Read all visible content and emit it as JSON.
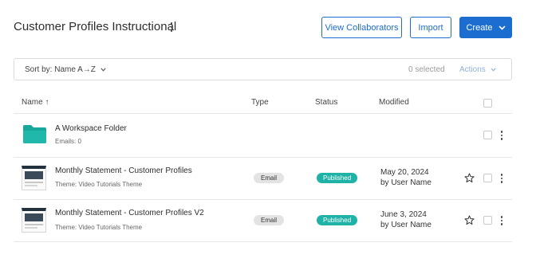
{
  "header": {
    "title": "Customer Profiles Instructional",
    "collaborators_label": "View Collaborators",
    "import_label": "Import",
    "create_label": "Create"
  },
  "toolbar": {
    "sort_label": "Sort by: Name A→Z",
    "selected_text": "0 selected",
    "actions_label": "Actions"
  },
  "table": {
    "columns": {
      "name": "Name ↑",
      "type": "Type",
      "status": "Status",
      "modified": "Modified"
    },
    "rows": [
      {
        "kind": "folder",
        "icon": "folder-icon",
        "title": "A Workspace Folder",
        "subtitle": "Emails: 0"
      },
      {
        "kind": "email",
        "icon": "email-thumbnail",
        "title": "Monthly Statement - Customer Profiles",
        "subtitle": "Theme: Video Tutorials Theme",
        "type": "Email",
        "status": "Published",
        "modified_date": "May 20, 2024",
        "modified_by": "by User Name"
      },
      {
        "kind": "email",
        "icon": "email-thumbnail",
        "title": "Monthly Statement - Customer Profiles V2",
        "subtitle": "Theme: Video Tutorials Theme",
        "type": "Email",
        "status": "Published",
        "modified_date": "June 3, 2024",
        "modified_by": "by User Name"
      }
    ]
  },
  "colors": {
    "primary": "#1b6ed0",
    "folder": "#17a89b",
    "published": "#1eb3a6",
    "actions_disabled": "#8fb1dd"
  }
}
